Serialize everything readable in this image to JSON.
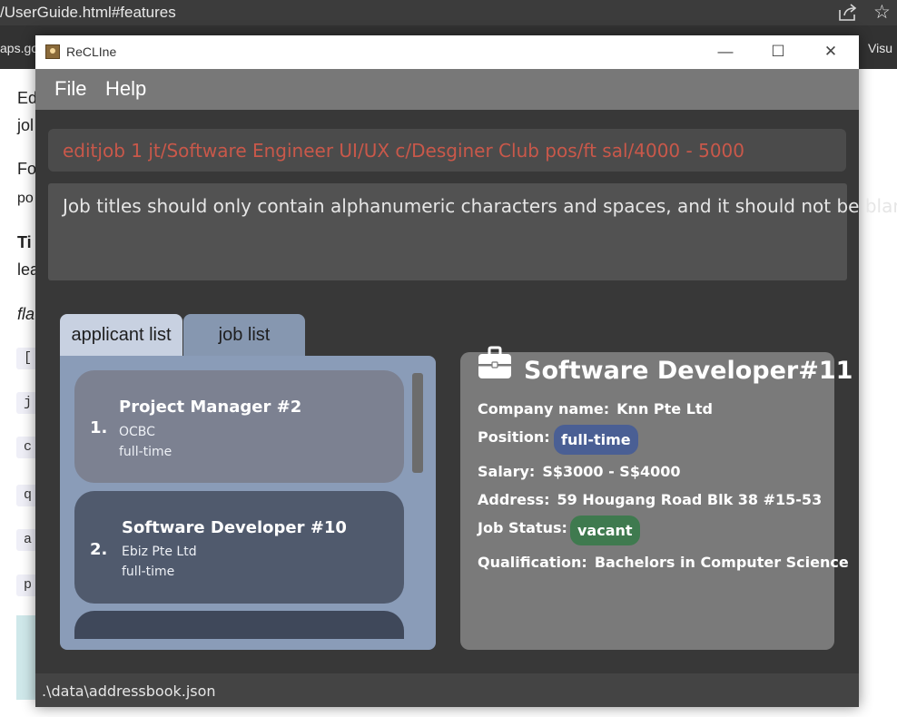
{
  "browser": {
    "url_fragment": "/UserGuide.html#features",
    "bookmark_left": "aps.go",
    "bookmark_right": "Visu"
  },
  "doc": {
    "fragments": [
      "Ed",
      "jol",
      "Fo",
      "po",
      "Ti",
      "lea",
      "fla"
    ],
    "chips": [
      "[",
      "j",
      "c",
      "q",
      "a",
      "p"
    ]
  },
  "window": {
    "title": "ReCLIne",
    "minimize_label": "—",
    "maximize_label": "☐",
    "close_label": "✕"
  },
  "menu": {
    "file": "File",
    "help": "Help"
  },
  "command": {
    "value": "editjob 1 jt/Software Engineer UI/UX c/Desginer Club pos/ft sal/4000 - 5000"
  },
  "result": {
    "text": "Job titles should only contain alphanumeric characters and spaces, and it should not be blank"
  },
  "tabs": {
    "applicant": "applicant list",
    "job": "job list"
  },
  "job_list": [
    {
      "index": "1.",
      "title": "Project Manager  #2",
      "company": "OCBC",
      "position": "full-time",
      "color": "#7c8191"
    },
    {
      "index": "2.",
      "title": "Software Developer  #10",
      "company": "Ebiz Pte Ltd",
      "position": "full-time",
      "color": "#505a6d"
    },
    {
      "index": "",
      "title": "",
      "company": "",
      "position": "",
      "color": "#3f485a"
    }
  ],
  "detail": {
    "title": "Software Developer#11",
    "company_label": "Company name:",
    "company_value": "Knn Pte Ltd",
    "position_label": "Position:",
    "position_value": "full-time",
    "position_color": "#4a5f94",
    "salary_label": "Salary:",
    "salary_value": "S$3000 - S$4000",
    "address_label": "Address:",
    "address_value": "59 Hougang Road Blk 38 #15-53",
    "status_label": "Job Status:",
    "status_value": "vacant",
    "status_color": "#3f7a4f",
    "qualification_label": "Qualification:",
    "qualification_value": "Bachelors in Computer Science"
  },
  "status_bar": {
    "path": ".\\data\\addressbook.json"
  }
}
